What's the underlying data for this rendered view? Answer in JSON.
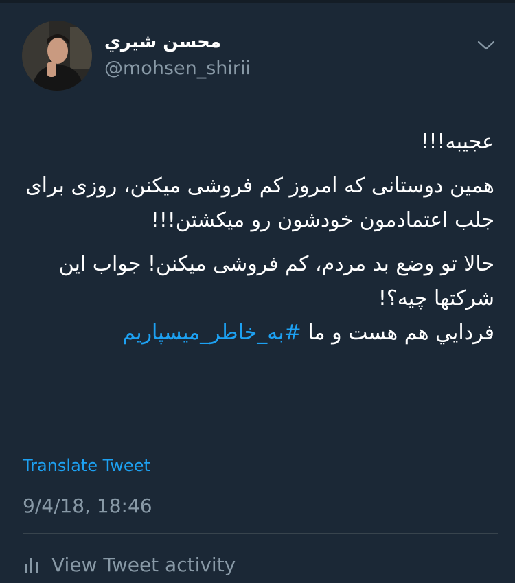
{
  "user": {
    "display_name": "محسن شيري",
    "handle": "@mohsen_shirii"
  },
  "tweet": {
    "line1": "عجیبه!!!",
    "paragraph2": "همین دوستانی که امروز کم فروشی میکنن، روزی برای جلب اعتمادمون خودشون رو میکشتن!!!",
    "paragraph3": "حالا تو وضع بد مردم، کم فروشی میکنن! جواب این شرکتها چیه؟!",
    "last_line_text": "فردايي هم هست و ما",
    "hashtag": "#به_خاطر_میسپاریم"
  },
  "actions": {
    "translate_label": "Translate Tweet",
    "activity_label": "View Tweet activity"
  },
  "timestamp": "9/4/18, 18:46",
  "icons": {
    "menu": "chevron-down-icon",
    "activity": "bar-chart-icon"
  },
  "colors": {
    "background": "#1b2836",
    "link": "#1da1f2",
    "secondary_text": "#8899a6",
    "divider": "#38444d"
  }
}
